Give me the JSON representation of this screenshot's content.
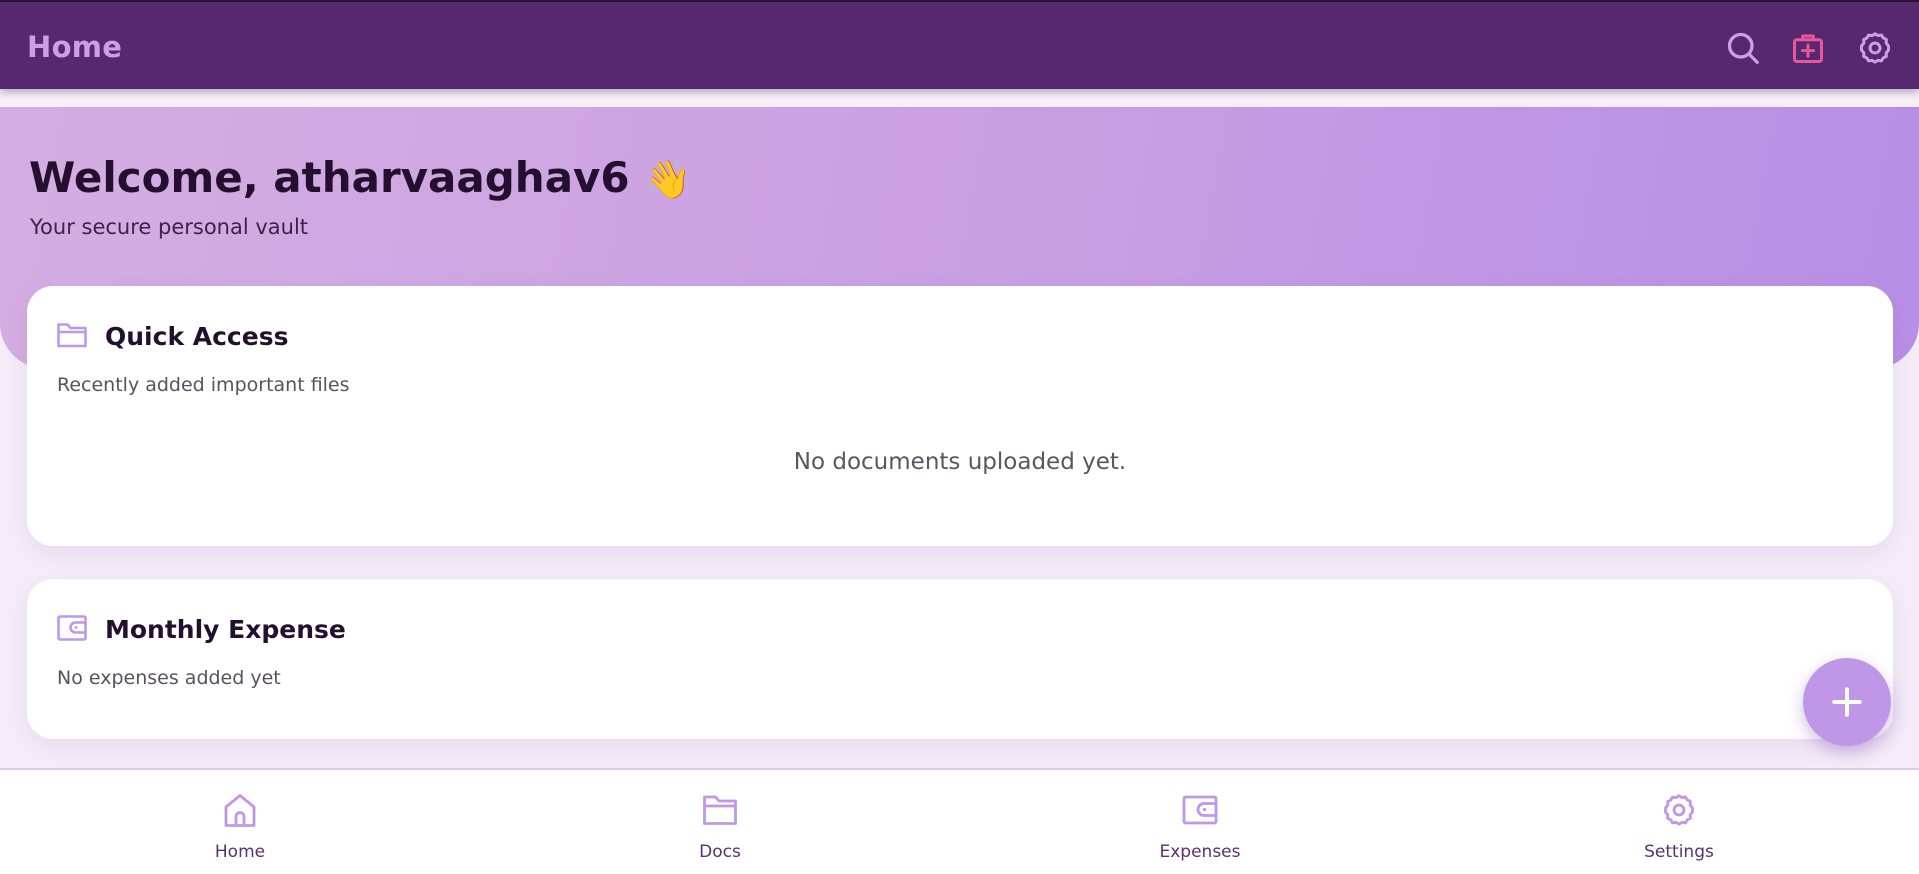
{
  "header": {
    "title": "Home",
    "icons": [
      "search-icon",
      "medical-kit-icon",
      "gear-icon"
    ]
  },
  "hero": {
    "title": "Welcome, atharvaaghav6",
    "emoji": "👋",
    "subtitle": "Your secure personal vault"
  },
  "quick_access": {
    "title": "Quick Access",
    "description": "Recently added important files",
    "empty_message": "No documents uploaded yet.",
    "icon": "folder-icon"
  },
  "monthly_expense": {
    "title": "Monthly Expense",
    "description": "No expenses added yet",
    "icon": "wallet-icon"
  },
  "fab": {
    "icon": "plus-icon"
  },
  "bottom_nav": {
    "items": [
      {
        "label": "Home",
        "icon": "home-icon"
      },
      {
        "label": "Docs",
        "icon": "folder-icon"
      },
      {
        "label": "Expenses",
        "icon": "wallet-icon"
      },
      {
        "label": "Settings",
        "icon": "gear-icon"
      }
    ]
  },
  "colors": {
    "topbar_bg": "#55286f",
    "topbar_title": "#c9a0e8",
    "accent": "#bf97e6",
    "medical_icon": "#e9579b",
    "hero_gradient_start": "#d4aee2",
    "hero_gradient_end": "#b88ee6",
    "nav_label": "#5a2f74"
  }
}
